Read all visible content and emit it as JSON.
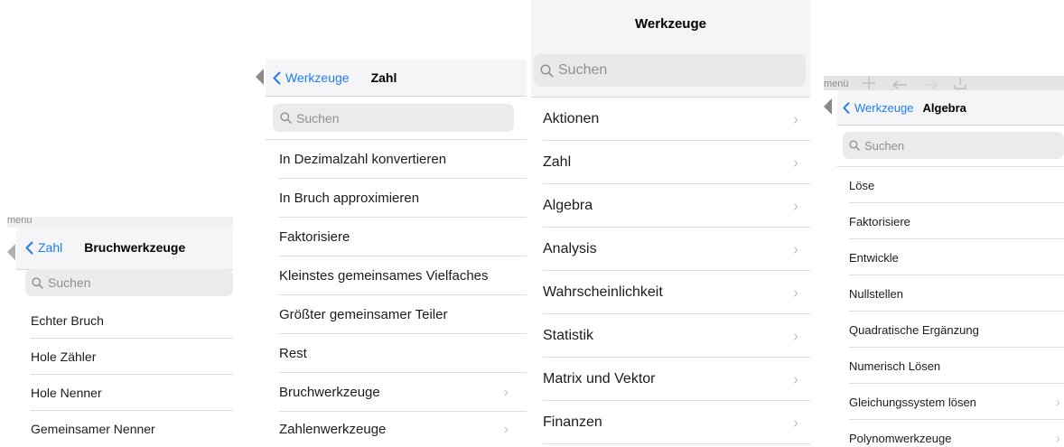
{
  "panel1": {
    "strip_text": "menu",
    "back_label": "Zahl",
    "title": "Bruchwerkzeuge",
    "search_placeholder": "Suchen",
    "items": [
      {
        "label": "Echter Bruch"
      },
      {
        "label": "Hole Zähler"
      },
      {
        "label": "Hole Nenner"
      },
      {
        "label": "Gemeinsamer Nenner"
      }
    ]
  },
  "panel2": {
    "back_label": "Werkzeuge",
    "title": "Zahl",
    "search_placeholder": "Suchen",
    "items": [
      {
        "label": "In Dezimalzahl konvertieren",
        "chevron": false
      },
      {
        "label": "In Bruch approximieren",
        "chevron": false
      },
      {
        "label": "Faktorisiere",
        "chevron": false
      },
      {
        "label": "Kleinstes gemeinsames Vielfaches",
        "chevron": false
      },
      {
        "label": "Größter gemeinsamer Teiler",
        "chevron": false
      },
      {
        "label": "Rest",
        "chevron": false
      },
      {
        "label": "Bruchwerkzeuge",
        "chevron": true
      },
      {
        "label": "Zahlenwerkzeuge",
        "chevron": true
      }
    ]
  },
  "panel3": {
    "title": "Werkzeuge",
    "search_placeholder": "Suchen",
    "items": [
      {
        "label": "Aktionen"
      },
      {
        "label": "Zahl"
      },
      {
        "label": "Algebra"
      },
      {
        "label": "Analysis"
      },
      {
        "label": "Wahrscheinlichkeit"
      },
      {
        "label": "Statistik"
      },
      {
        "label": "Matrix und Vektor"
      },
      {
        "label": "Finanzen"
      }
    ]
  },
  "panel4": {
    "strip_text": "menü",
    "back_label": "Werkzeuge",
    "title": "Algebra",
    "search_placeholder": "Suchen",
    "items": [
      {
        "label": "Löse",
        "chevron": false
      },
      {
        "label": "Faktorisiere",
        "chevron": false
      },
      {
        "label": "Entwickle",
        "chevron": false
      },
      {
        "label": "Nullstellen",
        "chevron": false
      },
      {
        "label": "Quadratische Ergänzung",
        "chevron": false
      },
      {
        "label": "Numerisch Lösen",
        "chevron": false
      },
      {
        "label": "Gleichungssystem lösen",
        "chevron": true
      },
      {
        "label": "Polynomwerkzeuge",
        "chevron": true
      }
    ]
  },
  "icons": {
    "chevron_right": "›",
    "back_chevron": "chevron-left-icon",
    "search": "magnifier-icon"
  },
  "colors": {
    "accent": "#1f7cf5",
    "header_bg": "#f5f5f7",
    "strip_bg": "#d7d7d9"
  }
}
